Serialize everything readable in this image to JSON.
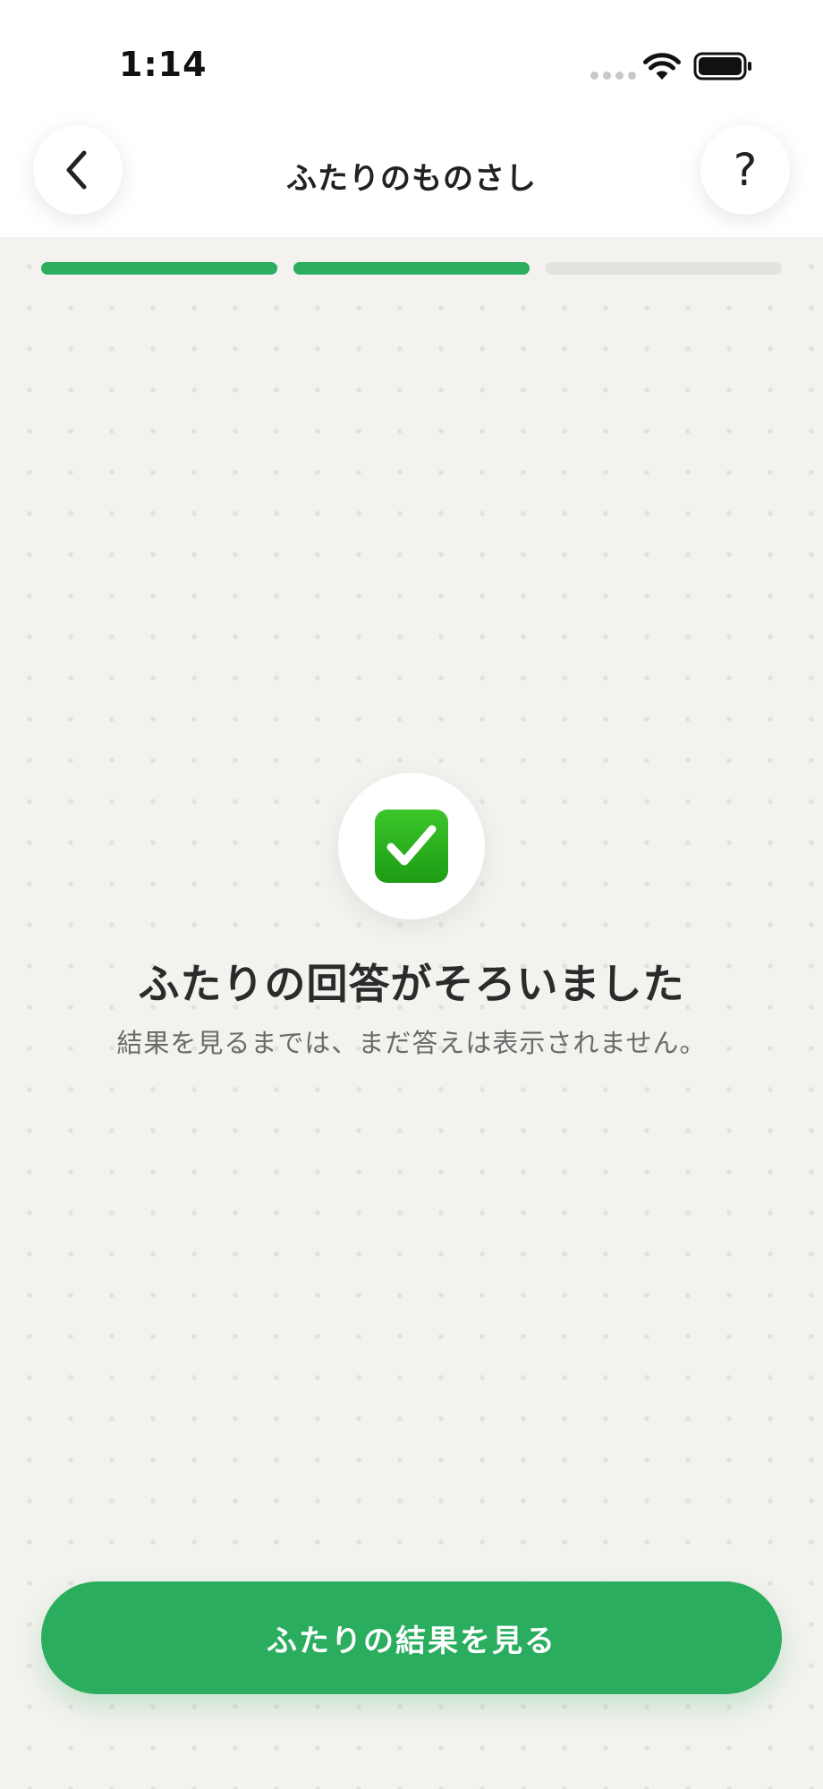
{
  "status_bar": {
    "time": "1:14",
    "signal_icon": "signal-dots-icon",
    "wifi_icon": "wifi-icon",
    "battery_icon": "battery-icon"
  },
  "header": {
    "title": "ふたりのものさし",
    "back_icon": "chevron-left-icon",
    "help_label": "?"
  },
  "progress": {
    "total_steps": 3,
    "completed_steps": 2
  },
  "main": {
    "badge_icon": "check-mark-icon",
    "headline": "ふたりの回答がそろいました",
    "subtext": "結果を見るまでは、まだ答えは表示されません。"
  },
  "cta": {
    "label": "ふたりの結果を見る"
  },
  "colors": {
    "accent": "#2aad5e",
    "background": "#f3f2ee",
    "check_green": "#2db31f"
  }
}
